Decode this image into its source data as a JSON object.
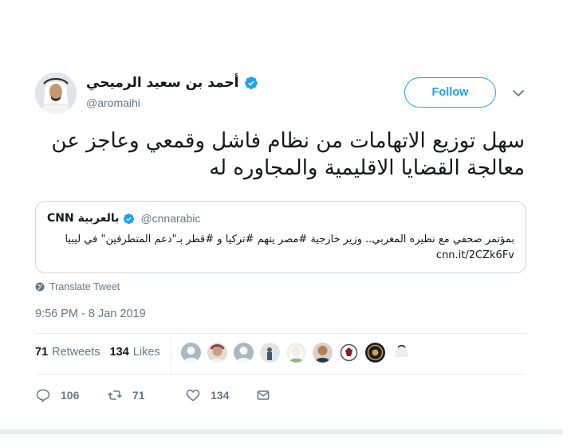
{
  "author": {
    "name": "أحمد بن سعيد الرميحي",
    "handle": "@aromaihi",
    "follow_label": "Follow"
  },
  "tweet": {
    "text": "سهل توزيع الاتهامات من نظام فاشل وقمعي وعاجز عن معالجة القضايا الاقليمية والمجاوره له"
  },
  "quote": {
    "name": "CNN بالعربية",
    "handle": "@cnnarabic",
    "text": "بمؤتمر صحفي مع نظيره المغربي.. وزير خارجية #مصر يتهم #تركيا و #قطر بـ\"دعم المتطرفين\" في ليبيا cnn.it/2CZk6Fv"
  },
  "translate_label": "Translate Tweet",
  "timestamp": "9:56 PM - 8 Jan 2019",
  "stats": {
    "retweets_count": "71",
    "retweets_label": "Retweets",
    "likes_count": "134",
    "likes_label": "Likes"
  },
  "actions": {
    "replies": "106",
    "retweets": "71",
    "likes": "134"
  },
  "colors": {
    "accent": "#1da1f2",
    "secondary_text": "#657786",
    "border": "#e6ecf0"
  },
  "icons": [
    "verified-badge-icon",
    "chevron-down-icon",
    "globe-icon",
    "reply-icon",
    "retweet-icon",
    "like-icon",
    "message-icon"
  ]
}
